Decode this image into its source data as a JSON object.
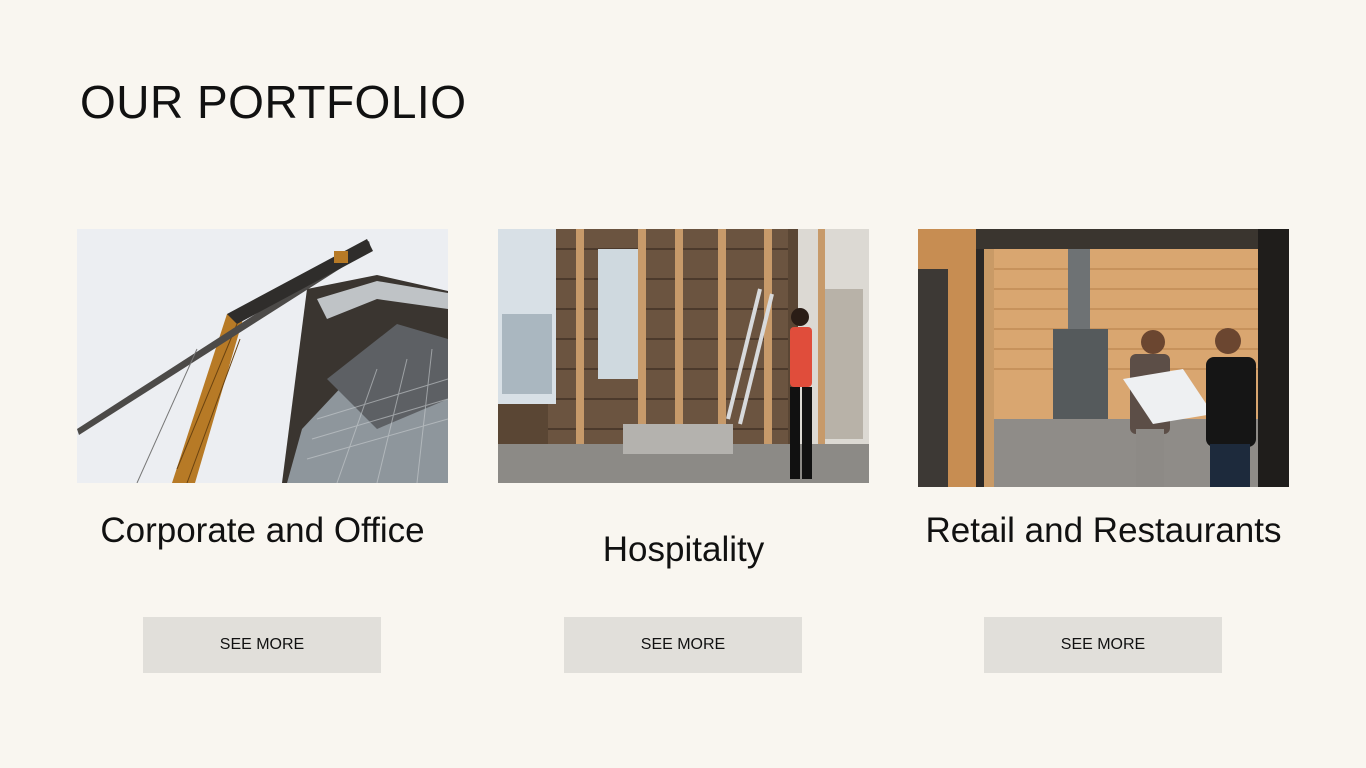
{
  "page": {
    "title": "OUR PORTFOLIO",
    "background": "#f9f6f0"
  },
  "cards": [
    {
      "title": "Corporate and Office",
      "button_label": "SEE MORE",
      "image": "crane-and-building-photo"
    },
    {
      "title": "Hospitality",
      "button_label": "SEE MORE",
      "image": "gutted-interior-renovation-photo"
    },
    {
      "title": "Retail and Restaurants",
      "button_label": "SEE MORE",
      "image": "two-workers-reviewing-plans-photo"
    }
  ],
  "colors": {
    "button_background": "#e1dfda",
    "text": "#111111"
  }
}
